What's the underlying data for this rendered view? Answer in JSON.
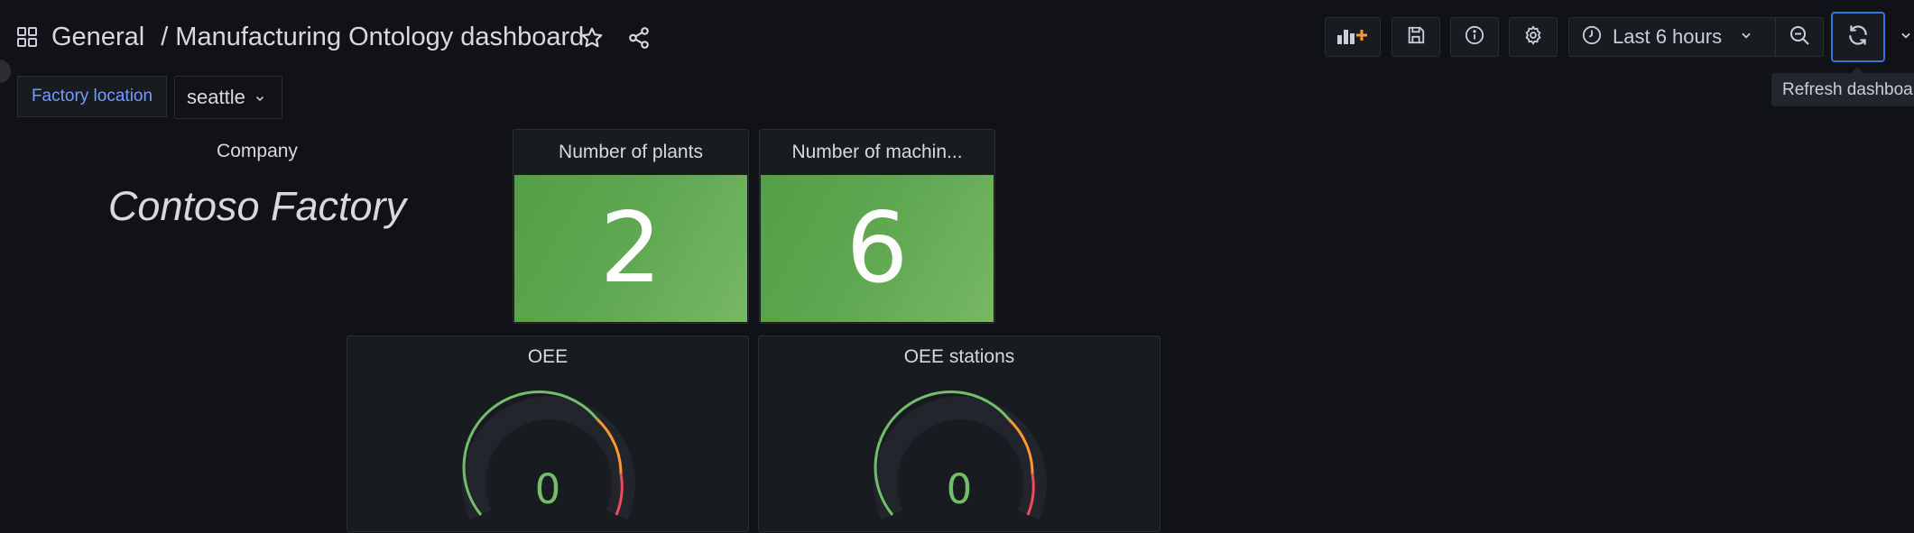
{
  "breadcrumb": {
    "folder": "General",
    "separator": "/",
    "dashboard_title": "Manufacturing Ontology dashboard"
  },
  "toolbar": {
    "time_range_label": "Last 6 hours",
    "refresh_tooltip": "Refresh dashboard",
    "icons": [
      "add-panel-icon",
      "save-icon",
      "info-icon",
      "settings-icon",
      "clock-icon",
      "zoom-out-icon",
      "refresh-icon",
      "chevron-down-icon"
    ]
  },
  "variables": {
    "factory_location": {
      "label": "Factory location",
      "value": "seattle"
    }
  },
  "panels": {
    "company": {
      "title": "Company",
      "value": "Contoso Factory"
    },
    "plants": {
      "title": "Number of plants",
      "value": "2"
    },
    "machines": {
      "title": "Number of machin...",
      "value": "6"
    },
    "oee": {
      "title": "OEE",
      "value": "0"
    },
    "oee_stations": {
      "title": "OEE stations",
      "value": "0"
    }
  },
  "colors": {
    "background": "#111217",
    "panel": "#181b1f",
    "accent_blue": "#3d71d9",
    "stat_green": "#5ea64f",
    "gauge_green": "#73bf69",
    "gauge_orange": "#ff9830",
    "gauge_red": "#f2495c",
    "star_color": "#d8d9da"
  }
}
